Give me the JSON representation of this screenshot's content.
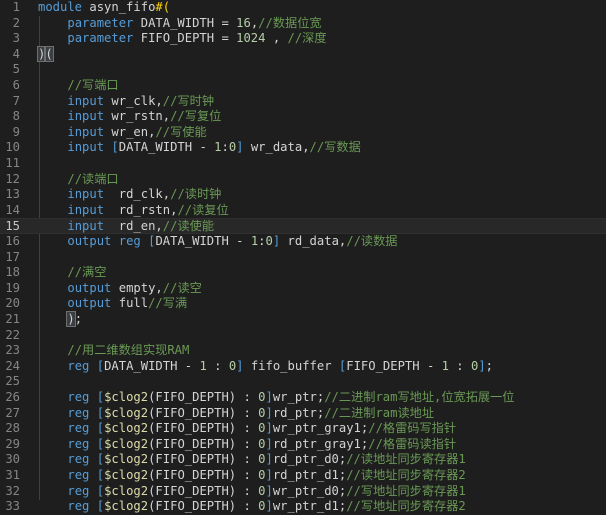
{
  "editor": {
    "lines": [
      {
        "n": "1",
        "segs": [
          {
            "c": "kw",
            "t": "module "
          },
          {
            "c": "id",
            "t": "asyn_fifo"
          },
          {
            "c": "brk",
            "t": "#("
          }
        ]
      },
      {
        "n": "2",
        "segs": [
          {
            "c": "id",
            "t": "    "
          },
          {
            "c": "kw",
            "t": "parameter "
          },
          {
            "c": "id",
            "t": "DATA_WIDTH = "
          },
          {
            "c": "num",
            "t": "16"
          },
          {
            "c": "id",
            "t": ","
          },
          {
            "c": "cm",
            "t": "//数据位宽"
          }
        ]
      },
      {
        "n": "3",
        "segs": [
          {
            "c": "id",
            "t": "    "
          },
          {
            "c": "kw",
            "t": "parameter "
          },
          {
            "c": "id",
            "t": "FIFO_DEPTH = "
          },
          {
            "c": "num",
            "t": "1024"
          },
          {
            "c": "id",
            "t": " , "
          },
          {
            "c": "cm",
            "t": "//深度"
          }
        ]
      },
      {
        "n": "4",
        "segs": [
          {
            "c": "hl",
            "t": ")"
          },
          {
            "c": "hl",
            "t": "("
          }
        ]
      },
      {
        "n": "5",
        "segs": []
      },
      {
        "n": "6",
        "segs": [
          {
            "c": "id",
            "t": "    "
          },
          {
            "c": "cm",
            "t": "//写端口"
          }
        ]
      },
      {
        "n": "7",
        "segs": [
          {
            "c": "id",
            "t": "    "
          },
          {
            "c": "kw",
            "t": "input "
          },
          {
            "c": "id",
            "t": "wr_clk,"
          },
          {
            "c": "cm",
            "t": "//写时钟"
          }
        ]
      },
      {
        "n": "8",
        "segs": [
          {
            "c": "id",
            "t": "    "
          },
          {
            "c": "kw",
            "t": "input "
          },
          {
            "c": "id",
            "t": "wr_rstn,"
          },
          {
            "c": "cm",
            "t": "//写复位"
          }
        ]
      },
      {
        "n": "9",
        "segs": [
          {
            "c": "id",
            "t": "    "
          },
          {
            "c": "kw",
            "t": "input "
          },
          {
            "c": "id",
            "t": "wr_en,"
          },
          {
            "c": "cm",
            "t": "//写使能"
          }
        ]
      },
      {
        "n": "10",
        "segs": [
          {
            "c": "id",
            "t": "    "
          },
          {
            "c": "kw",
            "t": "input "
          },
          {
            "c": "kw",
            "t": "["
          },
          {
            "c": "id",
            "t": "DATA_WIDTH - "
          },
          {
            "c": "num",
            "t": "1"
          },
          {
            "c": "id",
            "t": ":"
          },
          {
            "c": "num",
            "t": "0"
          },
          {
            "c": "kw",
            "t": "]"
          },
          {
            "c": "id",
            "t": " wr_data,"
          },
          {
            "c": "cm",
            "t": "//写数据"
          }
        ]
      },
      {
        "n": "11",
        "segs": []
      },
      {
        "n": "12",
        "segs": [
          {
            "c": "id",
            "t": "    "
          },
          {
            "c": "cm",
            "t": "//读端口"
          }
        ]
      },
      {
        "n": "13",
        "segs": [
          {
            "c": "id",
            "t": "    "
          },
          {
            "c": "kw",
            "t": "input  "
          },
          {
            "c": "id",
            "t": "rd_clk,"
          },
          {
            "c": "cm",
            "t": "//读时钟"
          }
        ]
      },
      {
        "n": "14",
        "segs": [
          {
            "c": "id",
            "t": "    "
          },
          {
            "c": "kw",
            "t": "input  "
          },
          {
            "c": "id",
            "t": "rd_rstn,"
          },
          {
            "c": "cm",
            "t": "//读复位"
          }
        ]
      },
      {
        "n": "15",
        "current": true,
        "segs": [
          {
            "c": "id",
            "t": "    "
          },
          {
            "c": "kw",
            "t": "input  "
          },
          {
            "c": "id",
            "t": "rd_en,"
          },
          {
            "c": "cm",
            "t": "//读使能"
          }
        ]
      },
      {
        "n": "16",
        "segs": [
          {
            "c": "id",
            "t": "    "
          },
          {
            "c": "kw",
            "t": "output "
          },
          {
            "c": "kw",
            "t": "reg "
          },
          {
            "c": "kw",
            "t": "["
          },
          {
            "c": "id",
            "t": "DATA_WIDTH - "
          },
          {
            "c": "num",
            "t": "1"
          },
          {
            "c": "id",
            "t": ":"
          },
          {
            "c": "num",
            "t": "0"
          },
          {
            "c": "kw",
            "t": "]"
          },
          {
            "c": "id",
            "t": " rd_data,"
          },
          {
            "c": "cm",
            "t": "//读数据"
          }
        ]
      },
      {
        "n": "17",
        "segs": []
      },
      {
        "n": "18",
        "segs": [
          {
            "c": "id",
            "t": "    "
          },
          {
            "c": "cm",
            "t": "//满空"
          }
        ]
      },
      {
        "n": "19",
        "segs": [
          {
            "c": "id",
            "t": "    "
          },
          {
            "c": "kw",
            "t": "output "
          },
          {
            "c": "id",
            "t": "empty,"
          },
          {
            "c": "cm",
            "t": "//读空"
          }
        ]
      },
      {
        "n": "20",
        "segs": [
          {
            "c": "id",
            "t": "    "
          },
          {
            "c": "kw",
            "t": "output "
          },
          {
            "c": "id",
            "t": "full"
          },
          {
            "c": "cm",
            "t": "//写满"
          }
        ]
      },
      {
        "n": "21",
        "segs": [
          {
            "c": "id",
            "t": "    "
          },
          {
            "c": "hl",
            "t": ")"
          },
          {
            "c": "id",
            "t": ";"
          }
        ]
      },
      {
        "n": "22",
        "segs": []
      },
      {
        "n": "23",
        "segs": [
          {
            "c": "id",
            "t": "    "
          },
          {
            "c": "cm",
            "t": "//用二维数组实现RAM"
          }
        ]
      },
      {
        "n": "24",
        "segs": [
          {
            "c": "id",
            "t": "    "
          },
          {
            "c": "kw",
            "t": "reg "
          },
          {
            "c": "kw",
            "t": "["
          },
          {
            "c": "id",
            "t": "DATA_WIDTH - "
          },
          {
            "c": "num",
            "t": "1"
          },
          {
            "c": "id",
            "t": " : "
          },
          {
            "c": "num",
            "t": "0"
          },
          {
            "c": "kw",
            "t": "]"
          },
          {
            "c": "id",
            "t": " fifo_buffer "
          },
          {
            "c": "kw",
            "t": "["
          },
          {
            "c": "id",
            "t": "FIFO_DEPTH - "
          },
          {
            "c": "num",
            "t": "1"
          },
          {
            "c": "id",
            "t": " : "
          },
          {
            "c": "num",
            "t": "0"
          },
          {
            "c": "kw",
            "t": "]"
          },
          {
            "c": "id",
            "t": ";"
          }
        ]
      },
      {
        "n": "25",
        "segs": []
      },
      {
        "n": "26",
        "segs": [
          {
            "c": "id",
            "t": "    "
          },
          {
            "c": "kw",
            "t": "reg "
          },
          {
            "c": "kw",
            "t": "["
          },
          {
            "c": "sys",
            "t": "$clog2"
          },
          {
            "c": "id",
            "t": "(FIFO_DEPTH) : "
          },
          {
            "c": "num",
            "t": "0"
          },
          {
            "c": "kw",
            "t": "]"
          },
          {
            "c": "id",
            "t": "wr_ptr;"
          },
          {
            "c": "cm",
            "t": "//二进制ram写地址,位宽拓展一位"
          }
        ]
      },
      {
        "n": "27",
        "segs": [
          {
            "c": "id",
            "t": "    "
          },
          {
            "c": "kw",
            "t": "reg "
          },
          {
            "c": "kw",
            "t": "["
          },
          {
            "c": "sys",
            "t": "$clog2"
          },
          {
            "c": "id",
            "t": "(FIFO_DEPTH) : "
          },
          {
            "c": "num",
            "t": "0"
          },
          {
            "c": "kw",
            "t": "]"
          },
          {
            "c": "id",
            "t": "rd_ptr;"
          },
          {
            "c": "cm",
            "t": "//二进制ram读地址"
          }
        ]
      },
      {
        "n": "28",
        "segs": [
          {
            "c": "id",
            "t": "    "
          },
          {
            "c": "kw",
            "t": "reg "
          },
          {
            "c": "kw",
            "t": "["
          },
          {
            "c": "sys",
            "t": "$clog2"
          },
          {
            "c": "id",
            "t": "(FIFO_DEPTH) : "
          },
          {
            "c": "num",
            "t": "0"
          },
          {
            "c": "kw",
            "t": "]"
          },
          {
            "c": "id",
            "t": "wr_ptr_gray1;"
          },
          {
            "c": "cm",
            "t": "//格雷码写指针"
          }
        ]
      },
      {
        "n": "29",
        "segs": [
          {
            "c": "id",
            "t": "    "
          },
          {
            "c": "kw",
            "t": "reg "
          },
          {
            "c": "kw",
            "t": "["
          },
          {
            "c": "sys",
            "t": "$clog2"
          },
          {
            "c": "id",
            "t": "(FIFO_DEPTH) : "
          },
          {
            "c": "num",
            "t": "0"
          },
          {
            "c": "kw",
            "t": "]"
          },
          {
            "c": "id",
            "t": "rd_ptr_gray1;"
          },
          {
            "c": "cm",
            "t": "//格雷码读指针"
          }
        ]
      },
      {
        "n": "30",
        "segs": [
          {
            "c": "id",
            "t": "    "
          },
          {
            "c": "kw",
            "t": "reg "
          },
          {
            "c": "kw",
            "t": "["
          },
          {
            "c": "sys",
            "t": "$clog2"
          },
          {
            "c": "id",
            "t": "(FIFO_DEPTH) : "
          },
          {
            "c": "num",
            "t": "0"
          },
          {
            "c": "kw",
            "t": "]"
          },
          {
            "c": "id",
            "t": "rd_ptr_d0;"
          },
          {
            "c": "cm",
            "t": "//读地址同步寄存器1"
          }
        ]
      },
      {
        "n": "31",
        "segs": [
          {
            "c": "id",
            "t": "    "
          },
          {
            "c": "kw",
            "t": "reg "
          },
          {
            "c": "kw",
            "t": "["
          },
          {
            "c": "sys",
            "t": "$clog2"
          },
          {
            "c": "id",
            "t": "(FIFO_DEPTH) : "
          },
          {
            "c": "num",
            "t": "0"
          },
          {
            "c": "kw",
            "t": "]"
          },
          {
            "c": "id",
            "t": "rd_ptr_d1;"
          },
          {
            "c": "cm",
            "t": "//读地址同步寄存器2"
          }
        ]
      },
      {
        "n": "32",
        "segs": [
          {
            "c": "id",
            "t": "    "
          },
          {
            "c": "kw",
            "t": "reg "
          },
          {
            "c": "kw",
            "t": "["
          },
          {
            "c": "sys",
            "t": "$clog2"
          },
          {
            "c": "id",
            "t": "(FIFO_DEPTH) : "
          },
          {
            "c": "num",
            "t": "0"
          },
          {
            "c": "kw",
            "t": "]"
          },
          {
            "c": "id",
            "t": "wr_ptr_d0;"
          },
          {
            "c": "cm",
            "t": "//写地址同步寄存器1"
          }
        ]
      },
      {
        "n": "33",
        "segs": [
          {
            "c": "id",
            "t": "    "
          },
          {
            "c": "kw",
            "t": "reg "
          },
          {
            "c": "kw",
            "t": "["
          },
          {
            "c": "sys",
            "t": "$clog2"
          },
          {
            "c": "id",
            "t": "(FIFO_DEPTH) : "
          },
          {
            "c": "num",
            "t": "0"
          },
          {
            "c": "kw",
            "t": "]"
          },
          {
            "c": "id",
            "t": "wr_ptr_d1;"
          },
          {
            "c": "cm",
            "t": "//写地址同步寄存器2"
          }
        ]
      }
    ]
  }
}
